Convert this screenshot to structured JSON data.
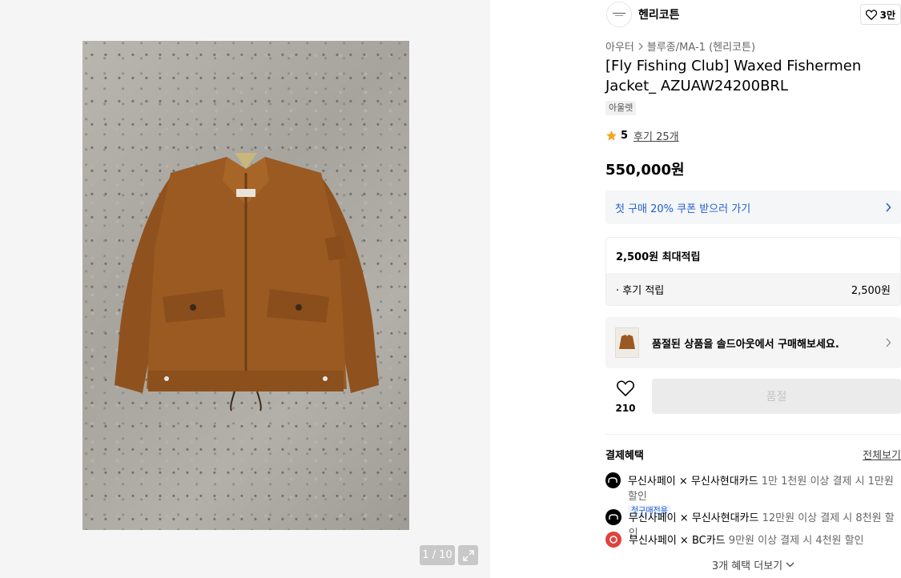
{
  "gallery": {
    "pager": "1 / 10",
    "image_alt": "brown waxed jacket on concrete"
  },
  "brand": {
    "name": "헨리코튼",
    "like_count": "3만"
  },
  "breadcrumb": {
    "category": "아우터",
    "subcategory": "블루종/MA-1 (헨리코튼)"
  },
  "product": {
    "title": "[Fly Fishing Club] Waxed Fishermen Jacket_ AZUAW24200BRL",
    "tag": "아울렛",
    "rating": "5",
    "reviews": "후기 25개",
    "price": "550,000원"
  },
  "coupon": {
    "label": "첫 구매 20% 쿠폰 받으러 가기"
  },
  "points": {
    "head": "2,500원 최대적립",
    "row_label": "· 후기 적립",
    "row_value": "2,500원"
  },
  "soldout": {
    "label": "품절된 상품을 솔드아웃에서 구매해보세요."
  },
  "actions": {
    "wish_count": "210",
    "buy_label": "품절"
  },
  "benefits": {
    "title": "결제혜택",
    "view_all": "전체보기",
    "items": [
      {
        "name": "무신사페이 × 무신사현대카드",
        "desc": "1만 1천원 이상 결제 시 1만원 할인",
        "tag": "첫구매전용"
      },
      {
        "name": "무신사페이 × 무신사현대카드",
        "desc": "12만원 이상 결제 시 8천원 할인"
      },
      {
        "name": "무신사페이 × BC카드",
        "desc": "9만원 이상 결제 시 4천원 할인"
      }
    ],
    "more": "3개 혜택 더보기"
  },
  "colors": {
    "accent_blue": "#1f5fd1",
    "star": "#f5a623",
    "jacket": "#9a5a22",
    "bc_red": "#e0433d"
  }
}
